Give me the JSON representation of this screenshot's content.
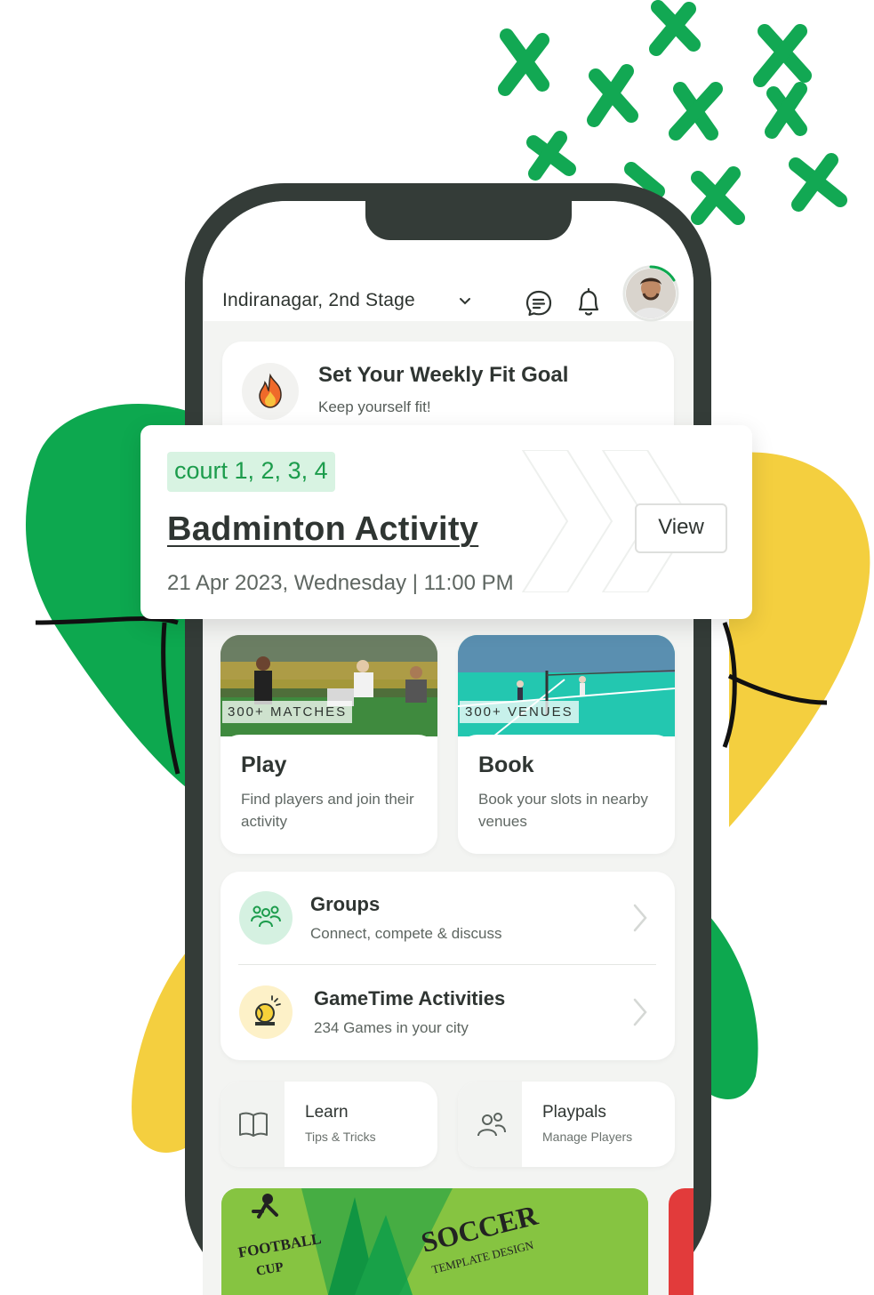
{
  "header": {
    "location": "Indiranagar, 2nd Stage",
    "icons": [
      "chat-icon",
      "bell-icon",
      "avatar"
    ]
  },
  "fit_goal": {
    "title": "Set Your Weekly Fit Goal",
    "subtitle": "Keep yourself fit!",
    "icon": "flame-icon"
  },
  "activity": {
    "chip": "court 1, 2, 3, 4",
    "title": "Badminton Activity",
    "datetime": "21 Apr 2023, Wednesday | 11:00 PM",
    "view_label": "View"
  },
  "tiles": [
    {
      "badge": "300+ MATCHES",
      "title": "Play",
      "desc": "Find players and join their activity"
    },
    {
      "badge": "300+ VENUES",
      "title": "Book",
      "desc": "Book your slots in nearby venues"
    }
  ],
  "list": [
    {
      "title": "Groups",
      "subtitle": "Connect, compete & discuss",
      "icon": "groups-icon"
    },
    {
      "title": "GameTime Activities",
      "subtitle": "234 Games in your city",
      "icon": "ball-icon"
    }
  ],
  "shortcuts": [
    {
      "title": "Learn",
      "subtitle": "Tips & Tricks",
      "icon": "book-icon"
    },
    {
      "title": "Playpals",
      "subtitle": "Manage Players",
      "icon": "people-icon"
    }
  ],
  "banner": {
    "left_text_1": "FOOTBALL",
    "left_text_2": "CUP",
    "main_text": "SOCCER",
    "sub_text": "TEMPLATE DESIGN"
  },
  "colors": {
    "brand_green": "#0da84f",
    "accent_yellow": "#f4cf3f",
    "phone_frame": "#343c38",
    "chip_bg": "#d8f3e2",
    "chip_text": "#1c9c4c"
  }
}
